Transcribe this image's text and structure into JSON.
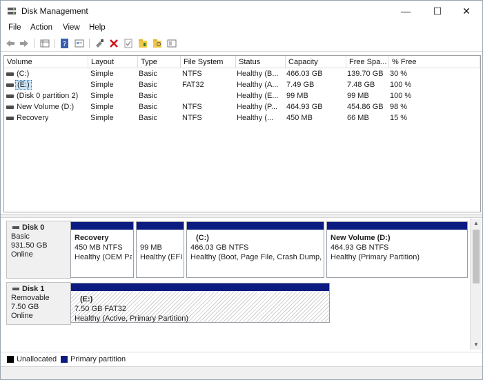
{
  "window": {
    "title": "Disk Management",
    "minimize_glyph": "—",
    "maximize_glyph": "☐",
    "close_glyph": "✕"
  },
  "menu": [
    "File",
    "Action",
    "View",
    "Help"
  ],
  "toolbar": {
    "icons": [
      "back-arrow-icon",
      "forward-arrow-icon",
      "list-view-icon",
      "help-icon",
      "properties-icon",
      "connect-icon",
      "delete-icon",
      "check-icon",
      "folder-icon",
      "folder-search-icon",
      "options-icon"
    ]
  },
  "volume_list": {
    "columns": [
      "Volume",
      "Layout",
      "Type",
      "File System",
      "Status",
      "Capacity",
      "Free Spa...",
      "% Free"
    ],
    "rows": [
      {
        "volume": "(C:)",
        "layout": "Simple",
        "type": "Basic",
        "fs": "NTFS",
        "status": "Healthy (B...",
        "capacity": "466.03 GB",
        "free": "139.70 GB",
        "pct": "30 %",
        "selected": false
      },
      {
        "volume": "(E:)",
        "layout": "Simple",
        "type": "Basic",
        "fs": "FAT32",
        "status": "Healthy (A...",
        "capacity": "7.49 GB",
        "free": "7.48 GB",
        "pct": "100 %",
        "selected": true
      },
      {
        "volume": "(Disk 0 partition 2)",
        "layout": "Simple",
        "type": "Basic",
        "fs": "",
        "status": "Healthy (E...",
        "capacity": "99 MB",
        "free": "99 MB",
        "pct": "100 %",
        "selected": false
      },
      {
        "volume": "New Volume (D:)",
        "layout": "Simple",
        "type": "Basic",
        "fs": "NTFS",
        "status": "Healthy (P...",
        "capacity": "464.93 GB",
        "free": "454.86 GB",
        "pct": "98 %",
        "selected": false
      },
      {
        "volume": "Recovery",
        "layout": "Simple",
        "type": "Basic",
        "fs": "NTFS",
        "status": "Healthy (...",
        "capacity": "450 MB",
        "free": "66 MB",
        "pct": "15 %",
        "selected": false
      }
    ]
  },
  "disks": [
    {
      "name": "Disk 0",
      "kind": "Basic",
      "size": "931.50 GB",
      "state": "Online",
      "partitions": [
        {
          "name": "Recovery",
          "size": "450 MB NTFS",
          "status": "Healthy (OEM Pa"
        },
        {
          "name": "",
          "size": "99 MB",
          "status": "Healthy (EFI"
        },
        {
          "name": "(C:)",
          "size": "466.03 GB NTFS",
          "status": "Healthy (Boot, Page File, Crash Dump,"
        },
        {
          "name": "New Volume  (D:)",
          "size": "464.93 GB NTFS",
          "status": "Healthy (Primary Partition)"
        }
      ]
    },
    {
      "name": "Disk 1",
      "kind": "Removable",
      "size": "7.50 GB",
      "state": "Online",
      "partitions": [
        {
          "name": "(E:)",
          "size": "7.50 GB FAT32",
          "status": "Healthy (Active, Primary Partition)"
        }
      ]
    }
  ],
  "legend": [
    {
      "label": "Unallocated",
      "color": "#000000"
    },
    {
      "label": "Primary partition",
      "color": "#0b1b82"
    }
  ],
  "colors": {
    "partition_bar": "#0b1b82",
    "selection": "#cce4f7"
  }
}
